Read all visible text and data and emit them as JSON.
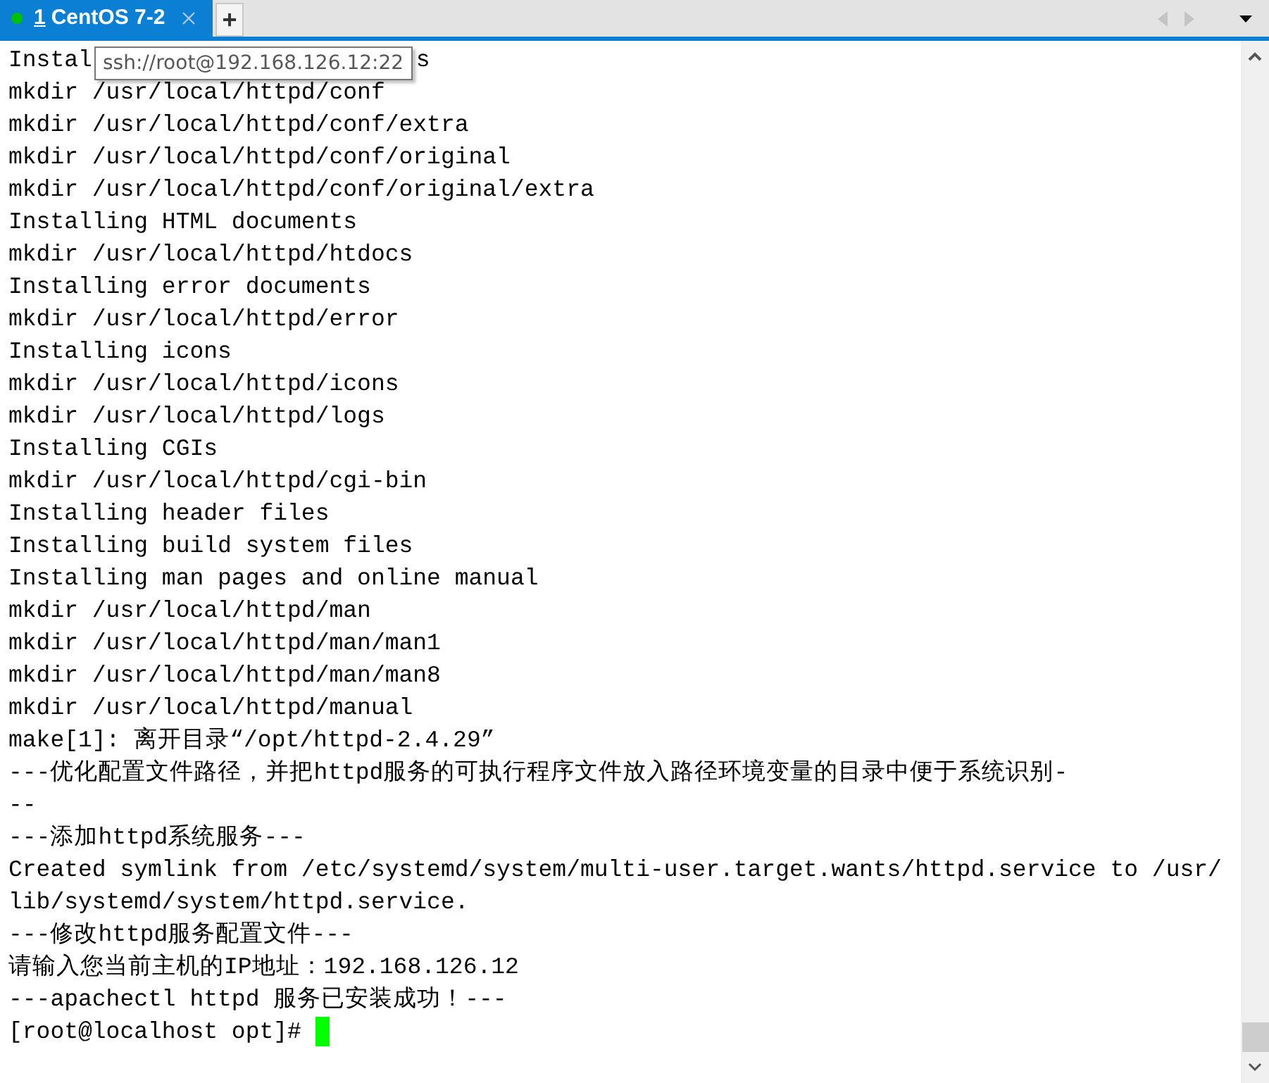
{
  "tabs": [
    {
      "number": "1",
      "title": "CentOS 7-2",
      "color": "#00c000",
      "selected": true
    }
  ],
  "new_tab": "+",
  "tooltip": "ssh://root@192.168.126.12:22",
  "terminal": {
    "first_line": {
      "text": "Instal",
      "tail": "s"
    },
    "lines": [
      "mkdir /usr/local/httpd/conf",
      "mkdir /usr/local/httpd/conf/extra",
      "mkdir /usr/local/httpd/conf/original",
      "mkdir /usr/local/httpd/conf/original/extra",
      "Installing HTML documents",
      "mkdir /usr/local/httpd/htdocs",
      "Installing error documents",
      "mkdir /usr/local/httpd/error",
      "Installing icons",
      "mkdir /usr/local/httpd/icons",
      "mkdir /usr/local/httpd/logs",
      "Installing CGIs",
      "mkdir /usr/local/httpd/cgi-bin",
      "Installing header files",
      "Installing build system files",
      "Installing man pages and online manual",
      "mkdir /usr/local/httpd/man",
      "mkdir /usr/local/httpd/man/man1",
      "mkdir /usr/local/httpd/man/man8",
      "mkdir /usr/local/httpd/manual",
      "make[1]: 离开目录“/opt/httpd-2.4.29”",
      "---优化配置文件路径，并把httpd服务的可执行程序文件放入路径环境变量的目录中便于系统识别-",
      "--",
      "---添加httpd系统服务---",
      "Created symlink from /etc/systemd/system/multi-user.target.wants/httpd.service to /usr/",
      "lib/systemd/system/httpd.service.",
      "---修改httpd服务配置文件---",
      "请输入您当前主机的IP地址：192.168.126.12",
      "---apachectl httpd 服务已安装成功！---"
    ],
    "prompt": "[root@localhost opt]#"
  }
}
